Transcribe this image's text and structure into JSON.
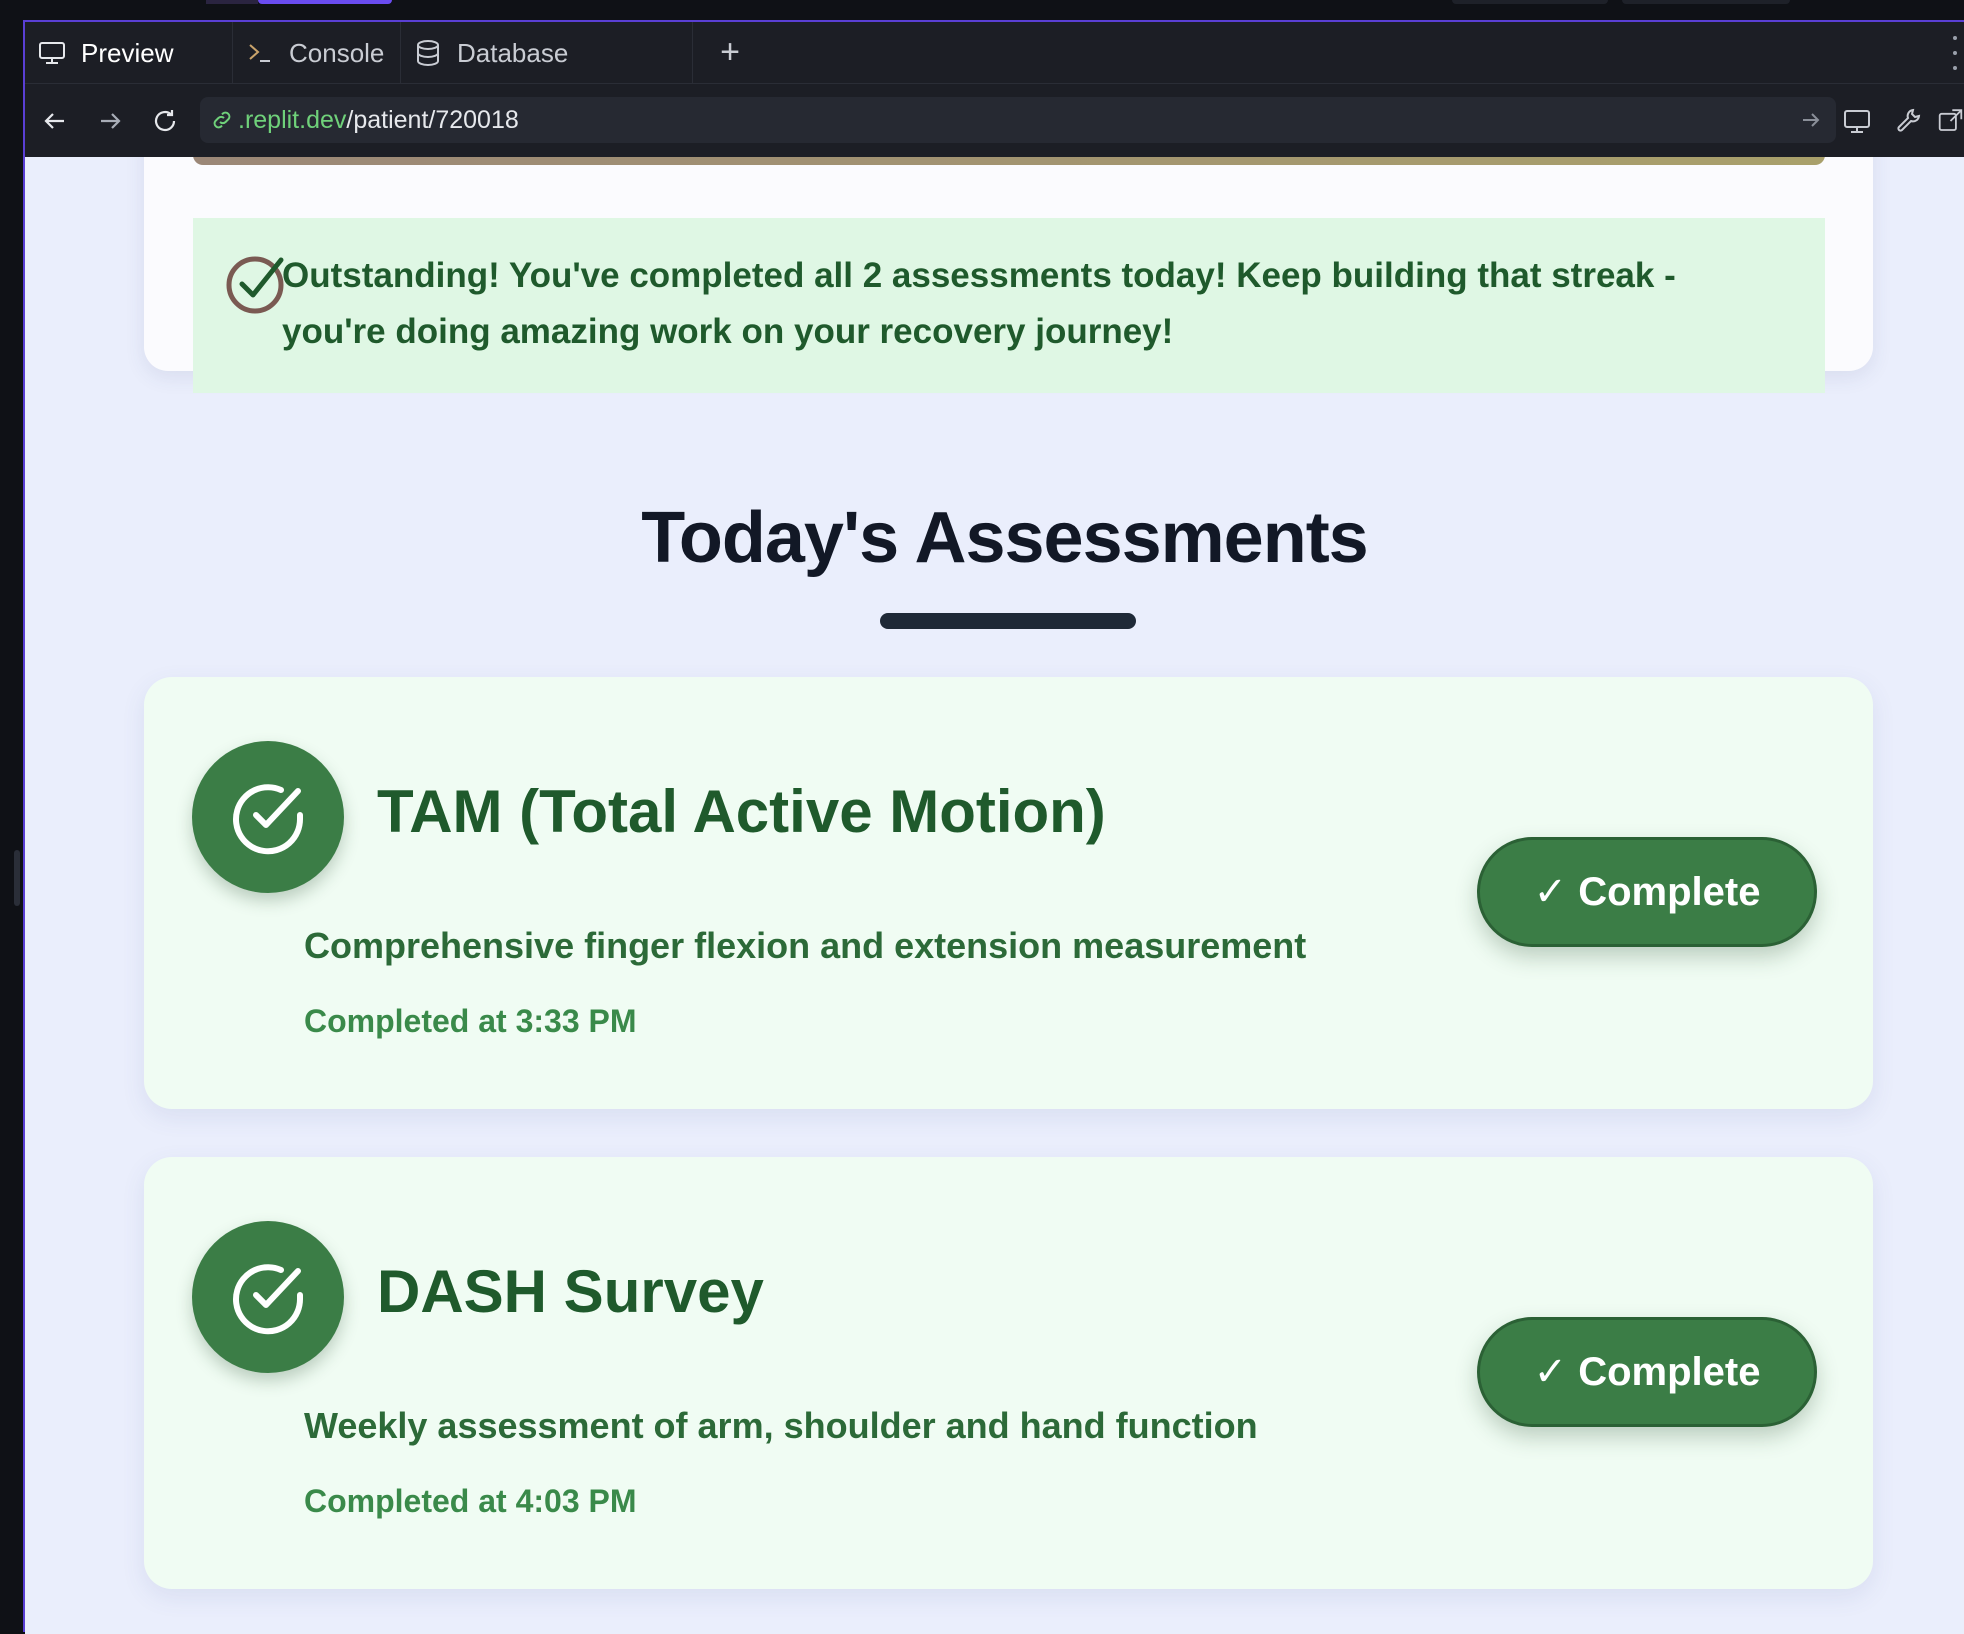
{
  "tabs": [
    {
      "label": "Preview",
      "icon": "monitor-icon",
      "active": true
    },
    {
      "label": "Console",
      "icon": "terminal-icon",
      "active": false
    },
    {
      "label": "Database",
      "icon": "database-icon",
      "active": false
    }
  ],
  "tab_add_label": "+",
  "url": {
    "host": ".replit.dev",
    "path": "/patient/720018"
  },
  "banner": {
    "message": "Outstanding! You've completed all 2 assessments today! Keep building that streak - you're doing amazing work on your recovery journey!"
  },
  "section": {
    "title": "Today's Assessments"
  },
  "assessments": [
    {
      "title": "TAM (Total Active Motion)",
      "description": "Comprehensive finger flexion and extension measurement",
      "completed_at": "Completed at 3:33 PM",
      "button_label": "✓ Complete"
    },
    {
      "title": "DASH Survey",
      "description": "Weekly assessment of arm, shoulder and hand function",
      "completed_at": "Completed at 4:03 PM",
      "button_label": "✓ Complete"
    }
  ],
  "colors": {
    "accent": "#5a3fd4",
    "success": "#3b7d46",
    "banner_bg": "#dff7e4",
    "page_bg": "#eaeefc"
  }
}
